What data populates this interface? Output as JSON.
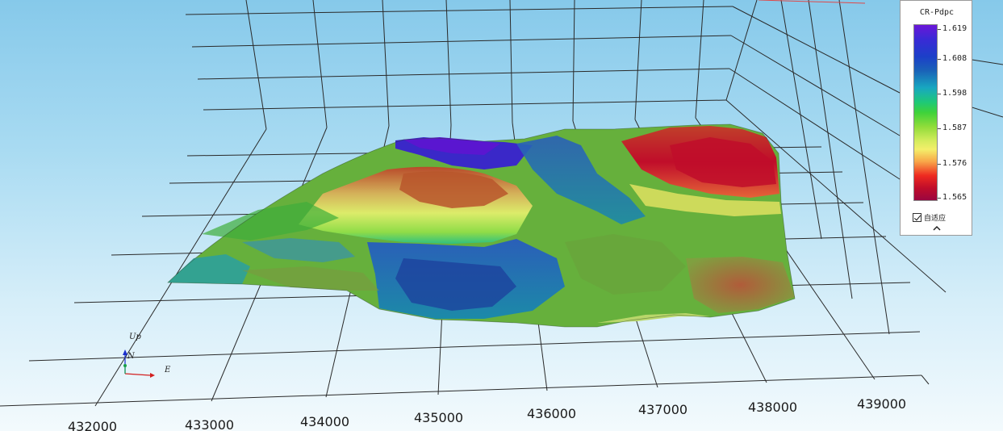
{
  "x_axis": {
    "tick_labels": [
      "432000",
      "433000",
      "434000",
      "435000",
      "436000",
      "437000",
      "438000",
      "439000"
    ]
  },
  "orientation": {
    "up_label": "Up",
    "north_label": "N",
    "east_label": "E"
  },
  "legend": {
    "title": "CR-Pdpc",
    "values": [
      "1.619",
      "1.608",
      "1.598",
      "1.587",
      "1.576",
      "1.565"
    ],
    "colormap": "rainbow",
    "adaptive_label": "自适应",
    "adaptive_checked": true
  },
  "colors": {
    "sky_top": "#86c9ea",
    "sky_bottom": "#f3fafd",
    "high_value": "#6a16d8",
    "low_value": "#9a0640"
  }
}
